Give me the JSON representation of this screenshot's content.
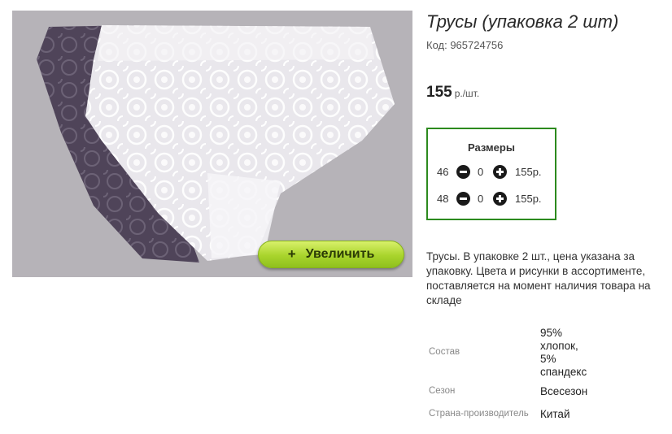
{
  "product": {
    "title": "Трусы (упаковка 2 шт)",
    "code": "Код: 965724756",
    "price": "155",
    "price_unit": "р./шт.",
    "zoom_label": "Увеличить",
    "zoom_plus": "+",
    "description": "Трусы. В упаковке 2 шт., цена указана за упаковку. Цвета и рисунки в ассортименте, поставляется на момент наличия товара на складе"
  },
  "sizes": {
    "title": "Размеры",
    "rows": [
      {
        "size": "46",
        "qty": "0",
        "price": "155р."
      },
      {
        "size": "48",
        "qty": "0",
        "price": "155р."
      }
    ]
  },
  "attributes": [
    {
      "label": "Состав",
      "value_lines": [
        "95%",
        "хлопок,",
        "5%",
        "спандекс"
      ]
    },
    {
      "label": "Сезон",
      "value": "Всесезон"
    },
    {
      "label": "Страна-производитель",
      "value": "Китай"
    }
  ],
  "colors": {
    "border_accent": "#2c8a1e",
    "zoom_button": "#a9d42c"
  },
  "icons": [
    "minus-circle-icon",
    "plus-circle-icon",
    "plus-icon"
  ]
}
